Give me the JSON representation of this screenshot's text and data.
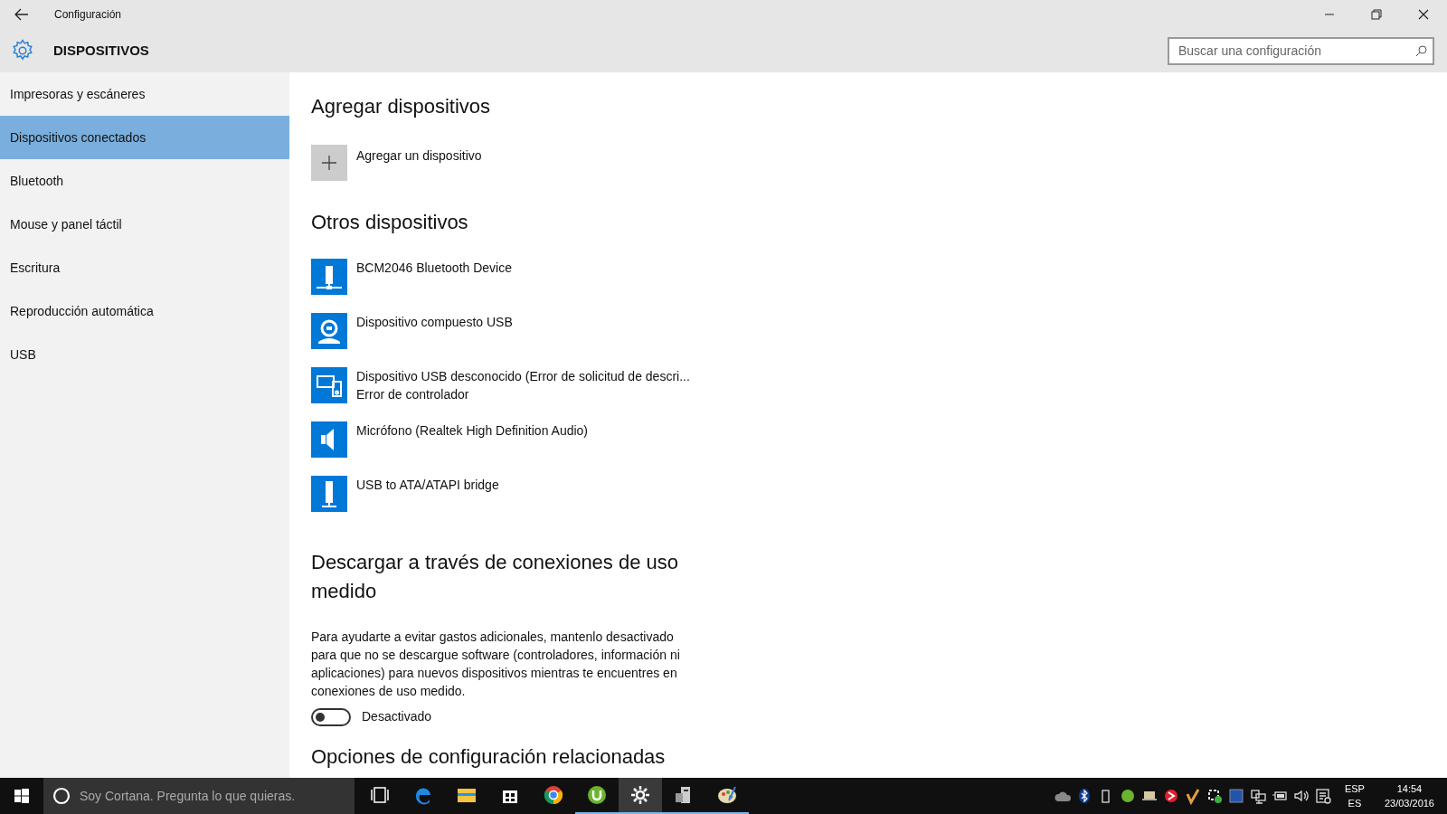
{
  "window": {
    "title": "Configuración"
  },
  "header": {
    "title": "DISPOSITIVOS",
    "search": {
      "placeholder": "Buscar una configuración"
    }
  },
  "sidebar": {
    "items": [
      {
        "label": "Impresoras y escáneres",
        "selected": false
      },
      {
        "label": "Dispositivos conectados",
        "selected": true
      },
      {
        "label": "Bluetooth",
        "selected": false
      },
      {
        "label": "Mouse y panel táctil",
        "selected": false
      },
      {
        "label": "Escritura",
        "selected": false
      },
      {
        "label": "Reproducción automática",
        "selected": false
      },
      {
        "label": "USB",
        "selected": false
      }
    ]
  },
  "add_section": {
    "title": "Agregar dispositivos",
    "button": "Agregar un dispositivo"
  },
  "other_section": {
    "title": "Otros dispositivos",
    "devices": [
      {
        "kind": "tower",
        "name": "BCM2046 Bluetooth Device"
      },
      {
        "kind": "webcam",
        "name": "Dispositivo compuesto USB"
      },
      {
        "kind": "devices",
        "name": "Dispositivo USB desconocido (Error de solicitud de descri...",
        "status": "Error de controlador"
      },
      {
        "kind": "speaker",
        "name": "Micrófono (Realtek High Definition Audio)"
      },
      {
        "kind": "drive",
        "name": "USB to ATA/ATAPI bridge"
      }
    ]
  },
  "metered_section": {
    "title": "Descargar a través de conexiones de uso medido",
    "description": "Para ayudarte a evitar gastos adicionales, mantenlo desactivado para que no se descargue software (controladores, información ni aplicaciones) para nuevos dispositivos mientras te encuentres en conexiones de uso medido.",
    "toggle": {
      "on": false,
      "label": "Desactivado"
    }
  },
  "related_section": {
    "title": "Opciones de configuración relacionadas"
  },
  "taskbar": {
    "search": {
      "placeholder": "Soy Cortana. Pregunta lo que quieras."
    },
    "apps": [
      {
        "kind": "taskview",
        "running": false,
        "selected": false
      },
      {
        "kind": "edge",
        "running": false,
        "selected": false
      },
      {
        "kind": "folder",
        "running": false,
        "selected": false
      },
      {
        "kind": "store",
        "running": false,
        "selected": false
      },
      {
        "kind": "chrome",
        "running": false,
        "selected": false
      },
      {
        "kind": "torrent",
        "running": true,
        "selected": false
      },
      {
        "kind": "gear",
        "running": true,
        "selected": true
      },
      {
        "kind": "server",
        "running": true,
        "selected": false
      },
      {
        "kind": "paint",
        "running": true,
        "selected": false
      }
    ],
    "language": {
      "top": "ESP",
      "bottom": "ES"
    },
    "time": "14:54",
    "date": "23/03/2016"
  }
}
